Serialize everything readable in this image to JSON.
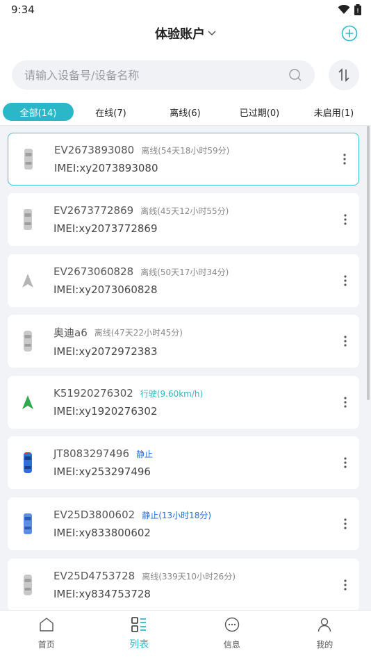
{
  "status_bar": {
    "time": "9:34",
    "battery_glyph": "!"
  },
  "header": {
    "title": "体验账户"
  },
  "search": {
    "placeholder": "请输入设备号/设备名称"
  },
  "tabs": [
    {
      "label": "全部(14)",
      "active": true
    },
    {
      "label": "在线(7)",
      "active": false
    },
    {
      "label": "离线(6)",
      "active": false
    },
    {
      "label": "已过期(0)",
      "active": false
    },
    {
      "label": "未启用(1)",
      "active": false
    }
  ],
  "devices": [
    {
      "name": "EV2673893080",
      "status": "离线(54天18小时59分)",
      "imei": "IMEI:xy2073893080",
      "icon": "gray-car-icon",
      "state": "offline"
    },
    {
      "name": "EV2673772869",
      "status": "离线(45天12小时55分)",
      "imei": "IMEI:xy2073772869",
      "icon": "gray-car-icon",
      "state": "offline"
    },
    {
      "name": "EV2673060828",
      "status": "离线(50天17小时34分)",
      "imei": "IMEI:xy2073060828",
      "icon": "gray-arrow-icon",
      "state": "offline"
    },
    {
      "name": "奥迪a6",
      "status": "离线(47天22小时45分)",
      "imei": "IMEI:xy2072972383",
      "icon": "gray-car-icon",
      "state": "offline"
    },
    {
      "name": "K51920276302",
      "status": "行驶(9.60km/h)",
      "imei": "IMEI:xy1920276302",
      "icon": "green-arrow-icon",
      "state": "driving"
    },
    {
      "name": "JT8083297496",
      "status": "静止",
      "imei": "IMEI:xy253297496",
      "icon": "blue-car-icon",
      "state": "still"
    },
    {
      "name": "EV25D3800602",
      "status": "静止(13小时18分)",
      "imei": "IMEI:xy833800602",
      "icon": "blue-car-icon",
      "state": "still"
    },
    {
      "name": "EV25D4753728",
      "status": "离线(339天10小时26分)",
      "imei": "IMEI:xy834753728",
      "icon": "gray-car-icon",
      "state": "offline"
    }
  ],
  "bottom_nav": [
    {
      "label": "首页",
      "icon": "home-icon",
      "active": false
    },
    {
      "label": "列表",
      "icon": "list-icon",
      "active": true
    },
    {
      "label": "信息",
      "icon": "message-icon",
      "active": false
    },
    {
      "label": "我的",
      "icon": "profile-icon",
      "active": false
    }
  ],
  "colors": {
    "accent": "#2ab8c8",
    "still": "#1e6fd6",
    "driving_icon": "#2fa84f"
  }
}
